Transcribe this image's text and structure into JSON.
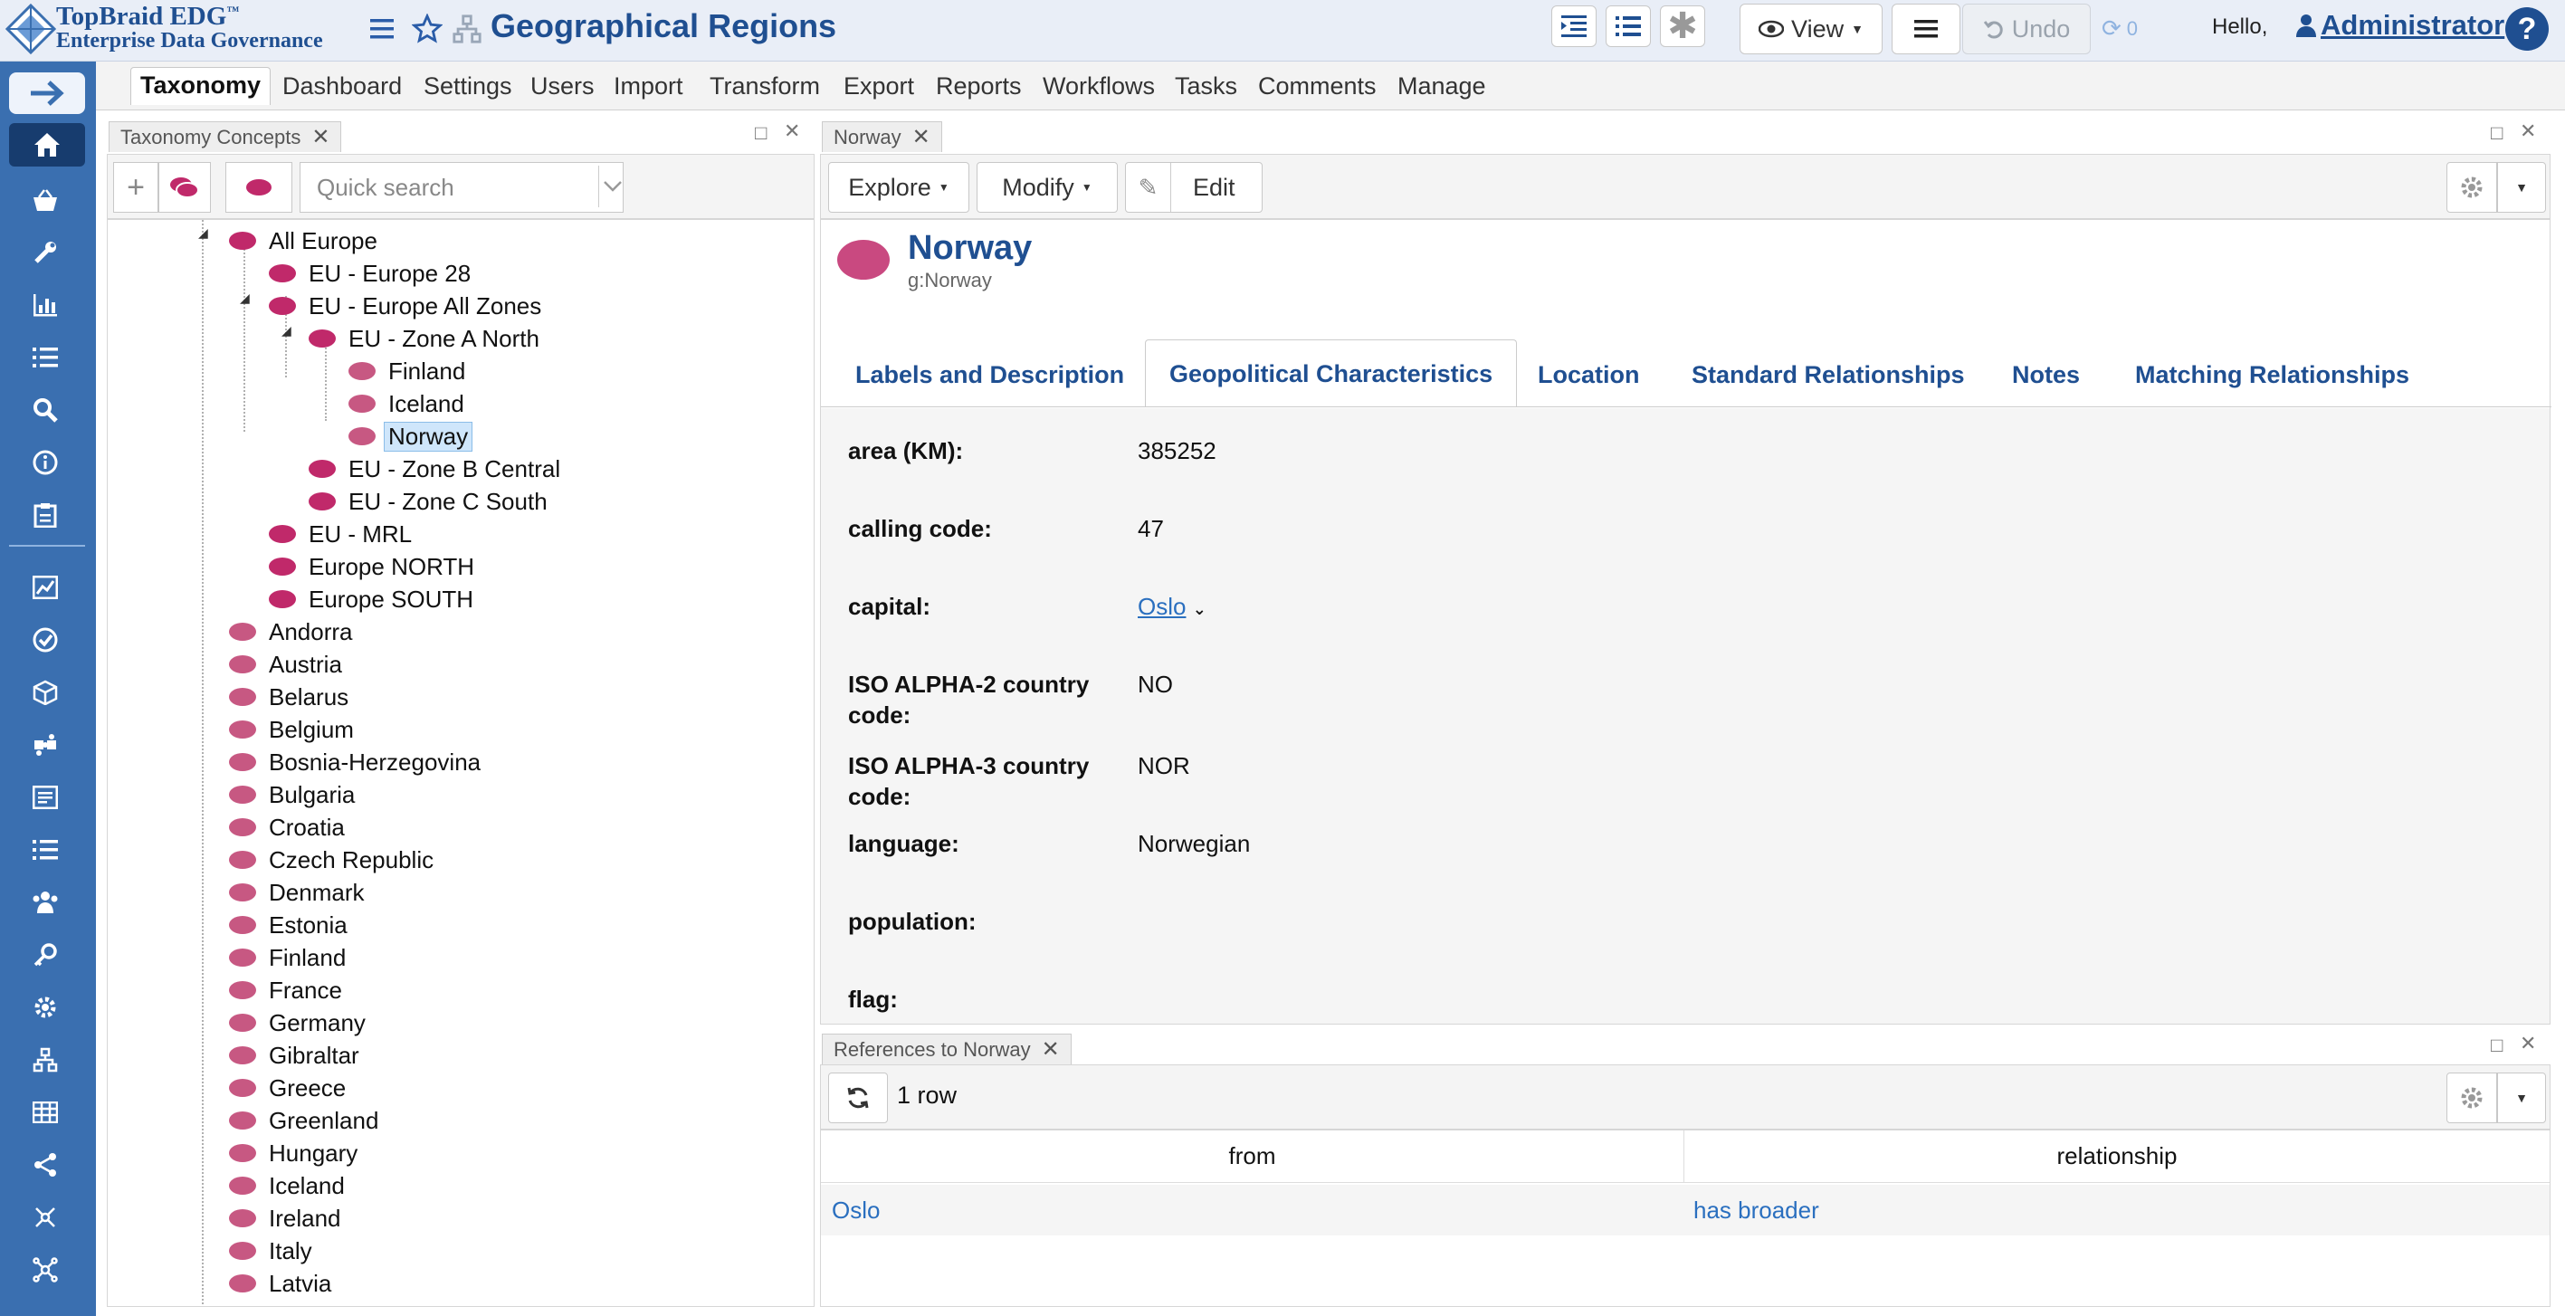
{
  "app": {
    "name": "TopBraid EDG",
    "trademark": "™",
    "subtitle": "Enterprise Data Governance"
  },
  "header": {
    "page_title": "Geographical Regions",
    "view_label": "View",
    "undo_label": "Undo",
    "redo_count": "0",
    "greeting": "Hello,",
    "user": "Administrator",
    "help": "?"
  },
  "nav": {
    "tabs": [
      "Taxonomy",
      "Dashboard",
      "Settings",
      "Users",
      "Import",
      "Transform",
      "Export",
      "Reports",
      "Workflows",
      "Tasks",
      "Comments",
      "Manage"
    ],
    "active": "Taxonomy"
  },
  "tree_panel": {
    "tab_label": "Taxonomy Concepts",
    "search_placeholder": "Quick search",
    "nodes": [
      "All Europe",
      "EU - Europe 28",
      "EU - Europe All Zones",
      "EU - Zone A North",
      "Finland",
      "Iceland",
      "Norway",
      "EU - Zone B Central",
      "EU - Zone C South",
      "EU - MRL",
      "Europe NORTH",
      "Europe SOUTH",
      "Andorra",
      "Austria",
      "Belarus",
      "Belgium",
      "Bosnia-Herzegovina",
      "Bulgaria",
      "Croatia",
      "Czech Republic",
      "Denmark",
      "Estonia",
      "Finland",
      "France",
      "Germany",
      "Gibraltar",
      "Greece",
      "Greenland",
      "Hungary",
      "Iceland",
      "Ireland",
      "Italy",
      "Latvia"
    ],
    "selected": "Norway"
  },
  "resource_panel": {
    "tab_label": "Norway",
    "explore_label": "Explore",
    "modify_label": "Modify",
    "edit_label": "Edit",
    "title": "Norway",
    "qname": "g:Norway",
    "tabs": [
      "Labels and Description",
      "Geopolitical Characteristics",
      "Location",
      "Standard Relationships",
      "Notes",
      "Matching Relationships"
    ],
    "active_tab": "Geopolitical Characteristics",
    "properties": [
      {
        "label": "area (KM):",
        "value": "385252"
      },
      {
        "label": "calling code:",
        "value": "47"
      },
      {
        "label": "capital:",
        "value": "Oslo"
      },
      {
        "label": "ISO ALPHA-2 country code:",
        "value": "NO"
      },
      {
        "label": "ISO ALPHA-3 country code:",
        "value": "NOR"
      },
      {
        "label": "language:",
        "value": "Norwegian"
      },
      {
        "label": "population:",
        "value": ""
      },
      {
        "label": "flag:",
        "value": ""
      }
    ]
  },
  "references_panel": {
    "tab_label": "References to Norway",
    "row_count": "1 row",
    "columns": [
      "from",
      "relationship"
    ],
    "rows": [
      {
        "from": "Oslo",
        "relationship": "has broader"
      }
    ]
  },
  "colors": {
    "brand": "#1f4f91",
    "rail": "#3a6fb0",
    "concept": "#c0296a",
    "link": "#2a6fbf",
    "selection": "#cfe6fb"
  }
}
